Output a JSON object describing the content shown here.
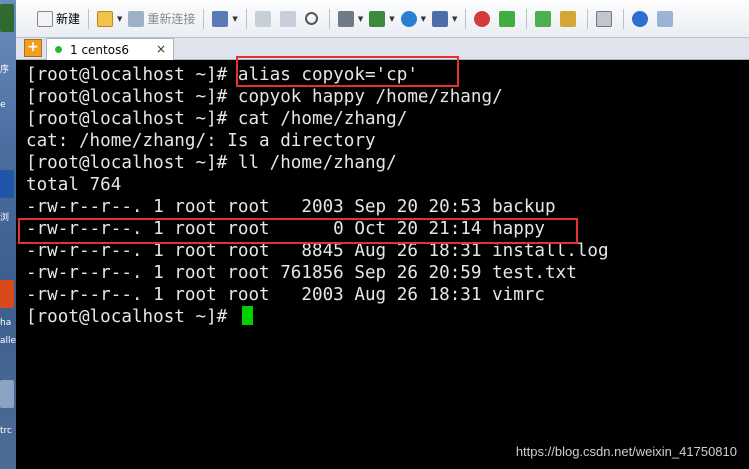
{
  "desktop": {
    "labels": [
      "序",
      "e",
      "浏",
      "ha",
      "alle",
      "trc"
    ]
  },
  "toolbar": {
    "new_label": "新建",
    "reconnect_label": "重新连接"
  },
  "tabs": [
    {
      "label": "1 centos6",
      "close": "×"
    }
  ],
  "tab_add": "+",
  "terminal": {
    "lines": [
      "[root@localhost ~]# alias copyok='cp'",
      "[root@localhost ~]# copyok happy /home/zhang/",
      "[root@localhost ~]# cat /home/zhang/",
      "cat: /home/zhang/: Is a directory",
      "[root@localhost ~]# ll /home/zhang/",
      "total 764",
      "-rw-r--r--. 1 root root   2003 Sep 20 20:53 backup",
      "-rw-r--r--. 1 root root      0 Oct 20 21:14 happy",
      "-rw-r--r--. 1 root root   8845 Aug 26 18:31 install.log",
      "-rw-r--r--. 1 root root 761856 Sep 26 20:59 test.txt",
      "-rw-r--r--. 1 root root   2003 Aug 26 18:31 vimrc",
      "[root@localhost ~]# "
    ]
  },
  "watermark": "https://blog.csdn.net/weixin_41750810",
  "colors": {
    "highlight_box": "#e53030",
    "cursor": "#00d000",
    "terminal_bg": "#000000",
    "terminal_fg": "#e6e6e6"
  }
}
